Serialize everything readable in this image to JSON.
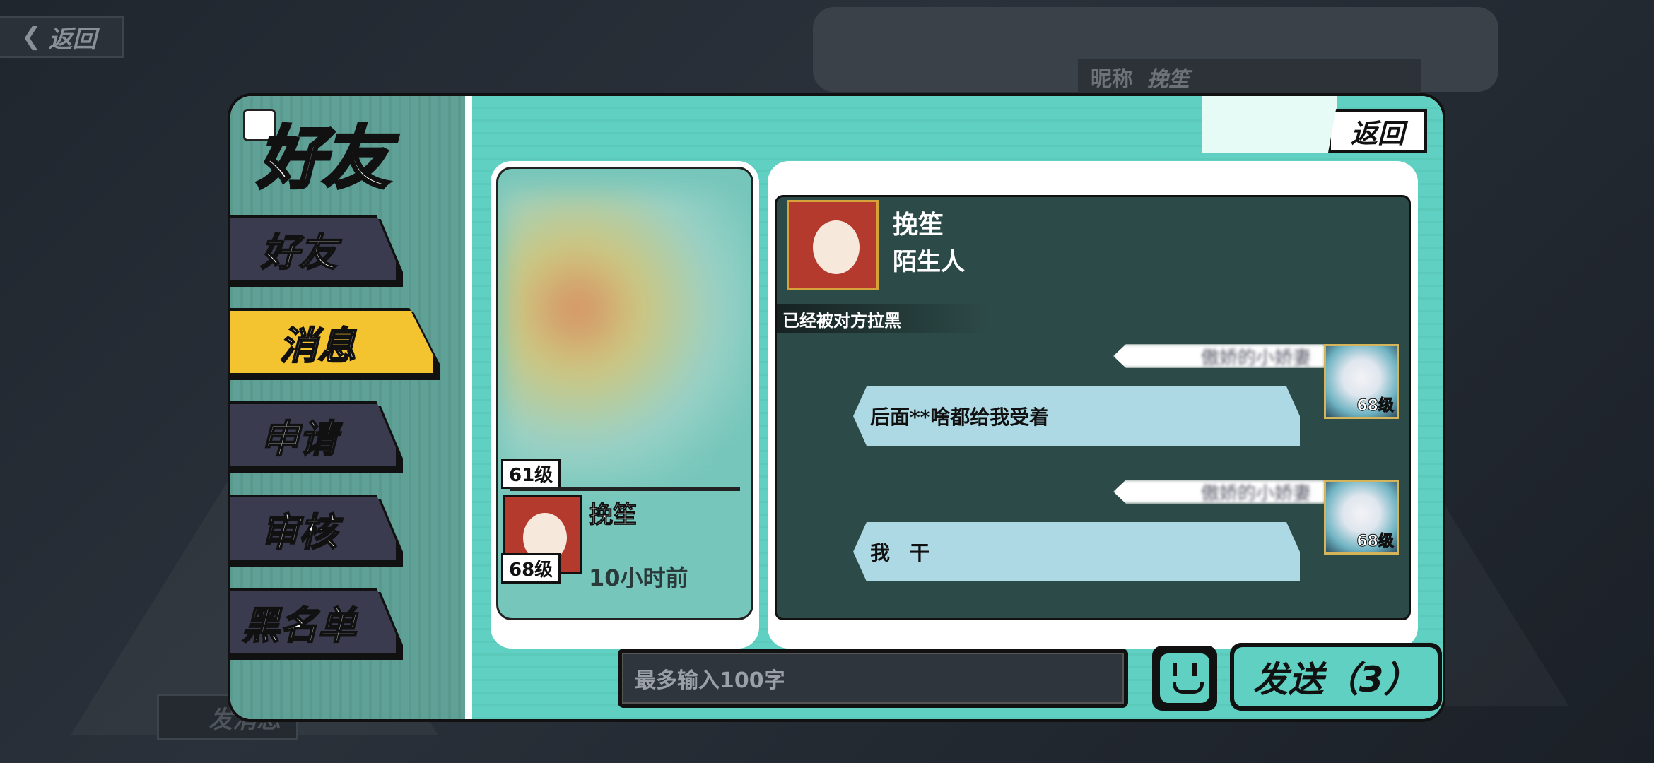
{
  "background": {
    "back_label": "返回",
    "nickname_label": "昵称",
    "nickname_value": "挽笙",
    "bottom_send_label": "发消息"
  },
  "dialog": {
    "title": "好友",
    "back_label": "返回",
    "tabs": [
      {
        "label": "好友",
        "active": false
      },
      {
        "label": "消息",
        "active": true
      },
      {
        "label": "申请",
        "active": false
      },
      {
        "label": "审核",
        "active": false
      },
      {
        "label": "黑名单",
        "active": false
      }
    ]
  },
  "friend_list": {
    "items": [
      {
        "level": "61级",
        "name": "",
        "time": ""
      },
      {
        "level": "68级",
        "name": "挽笙",
        "time": "10小时前"
      }
    ]
  },
  "chat": {
    "contact_name": "挽笙",
    "contact_relation": "陌生人",
    "contact_level": "68级",
    "blocked_notice": "已经被对方拉黑",
    "messages": [
      {
        "sender": "傲娇的小娇妻",
        "text": "后面**啥都给我受着",
        "level": "68级"
      },
      {
        "sender": "傲娇的小娇妻",
        "text": "我　干",
        "level": "68级"
      }
    ]
  },
  "input": {
    "placeholder": "最多输入100字",
    "send_label": "发送（3）"
  },
  "colors": {
    "accent_teal": "#5fd0c1",
    "active_tab": "#f4c430",
    "tab_dark": "#3b3b50",
    "chat_bg": "#2c4a48",
    "bubble": "#add9e5"
  }
}
